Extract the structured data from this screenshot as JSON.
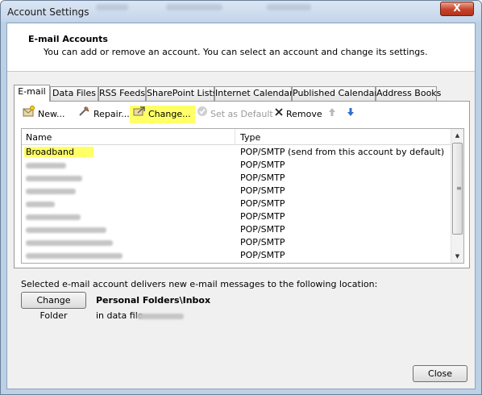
{
  "window": {
    "title": "Account Settings",
    "close_label": "X"
  },
  "header": {
    "title": "E-mail Accounts",
    "description": "You can add or remove an account. You can select an account and change its settings."
  },
  "tabs": [
    "E-mail",
    "Data Files",
    "RSS Feeds",
    "SharePoint Lists",
    "Internet Calendars",
    "Published Calendars",
    "Address Books"
  ],
  "toolbar": {
    "new": "New...",
    "repair": "Repair...",
    "change": "Change...",
    "set_default": "Set as Default",
    "remove": "Remove"
  },
  "list": {
    "columns": {
      "name": "Name",
      "type": "Type"
    },
    "rows": [
      {
        "name": "Broadband",
        "type": "POP/SMTP (send from this account by default)"
      },
      {
        "name": "",
        "type": "POP/SMTP"
      },
      {
        "name": "",
        "type": "POP/SMTP"
      },
      {
        "name": "",
        "type": "POP/SMTP"
      },
      {
        "name": "",
        "type": "POP/SMTP"
      },
      {
        "name": "",
        "type": "POP/SMTP"
      },
      {
        "name": "",
        "type": "POP/SMTP"
      },
      {
        "name": "",
        "type": "POP/SMTP"
      },
      {
        "name": "",
        "type": "POP/SMTP"
      }
    ]
  },
  "delivery": {
    "text": "Selected e-mail account delivers new e-mail messages to the following location:",
    "change_folder_label": "Change Folder",
    "folder": "Personal Folders\\Inbox",
    "datafile_prefix": "in data file"
  },
  "footer": {
    "close_label": "Close"
  },
  "colors": {
    "highlight": "#ffff66",
    "title_bar": "#c4d5ea",
    "close_red": "#c7432a"
  }
}
